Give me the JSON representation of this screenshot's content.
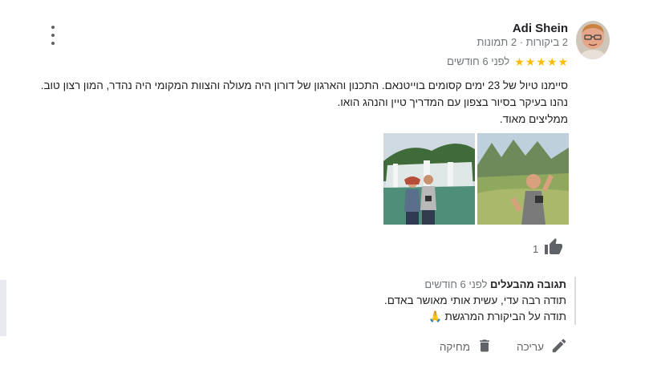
{
  "reviewer": {
    "name": "Adi Shein",
    "meta": "2 ביקורות · 2 תמונות"
  },
  "review": {
    "stars": 5,
    "star_glyph": "★",
    "time_ago": "לפני 6 חודשים",
    "lines": [
      "סיימנו טיול של 23 ימים קסומים בוייטנאם. התכנון והארגון של דורון היה מעולה והצוות המקומי היה נהדר, המון רצון טוב.",
      "נהנו בעיקר בסיור בצפון עם המדריך טיין והנהג הואו.",
      "ממליצים מאוד."
    ],
    "likes": "1"
  },
  "owner_response": {
    "title": "תגובה מהבעלים",
    "time_ago": "לפני 6 חודשים",
    "lines": [
      "תודה רבה עדי, עשית אותי מאושר באדם.",
      "תודה על הביקורת המרגשת"
    ],
    "emoji": "🙏"
  },
  "actions": {
    "edit_label": "עריכה",
    "delete_label": "מחיקה"
  },
  "colors": {
    "star": "#fbbc04",
    "icon_gray": "#5f6368"
  }
}
